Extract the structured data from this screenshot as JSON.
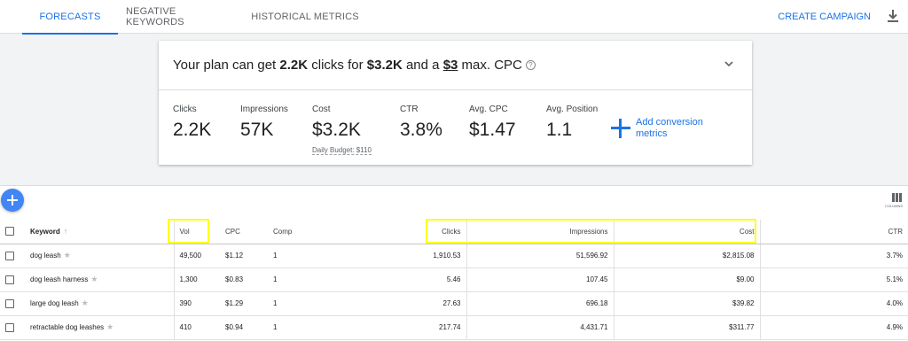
{
  "tabs": [
    {
      "label": "FORECASTS",
      "active": true
    },
    {
      "label": "NEGATIVE KEYWORDS",
      "active": false
    },
    {
      "label": "HISTORICAL METRICS",
      "active": false
    }
  ],
  "create_campaign": "CREATE CAMPAIGN",
  "plan": {
    "prefix": "Your plan can get ",
    "clicks": "2.2K",
    "mid1": " clicks for ",
    "cost": "$3.2K",
    "mid2": " and a ",
    "cpc": "$3",
    "suffix": " max. CPC",
    "help": "?"
  },
  "metrics": {
    "clicks": {
      "label": "Clicks",
      "value": "2.2K"
    },
    "impressions": {
      "label": "Impressions",
      "value": "57K"
    },
    "cost": {
      "label": "Cost",
      "value": "$3.2K",
      "sub": "Daily Budget: $110"
    },
    "ctr": {
      "label": "CTR",
      "value": "3.8%"
    },
    "avg_cpc": {
      "label": "Avg. CPC",
      "value": "$1.47"
    },
    "avg_position": {
      "label": "Avg. Position",
      "value": "1.1"
    }
  },
  "add_conversion": "Add conversion metrics",
  "columns_label": "COLUMNS",
  "table": {
    "headers": {
      "keyword": "Keyword",
      "vol": "Vol",
      "cpc": "CPC",
      "comp": "Comp",
      "clicks": "Clicks",
      "impressions": "Impressions",
      "cost": "Cost",
      "ctr": "CTR"
    },
    "rows": [
      {
        "keyword": "dog leash",
        "vol": "49,500",
        "cpc": "$1.12",
        "comp": "1",
        "clicks": "1,910.53",
        "impressions": "51,596.92",
        "cost": "$2,815.08",
        "ctr": "3.7%"
      },
      {
        "keyword": "dog leash harness",
        "vol": "1,300",
        "cpc": "$0.83",
        "comp": "1",
        "clicks": "5.46",
        "impressions": "107.45",
        "cost": "$9.00",
        "ctr": "5.1%"
      },
      {
        "keyword": "large dog leash",
        "vol": "390",
        "cpc": "$1.29",
        "comp": "1",
        "clicks": "27.63",
        "impressions": "696.18",
        "cost": "$39.82",
        "ctr": "4.0%"
      },
      {
        "keyword": "retractable dog leashes",
        "vol": "410",
        "cpc": "$0.94",
        "comp": "1",
        "clicks": "217.74",
        "impressions": "4,431.71",
        "cost": "$311.77",
        "ctr": "4.9%"
      }
    ]
  },
  "colors": {
    "accent": "#1a73e8",
    "highlight": "#ffff1a"
  }
}
